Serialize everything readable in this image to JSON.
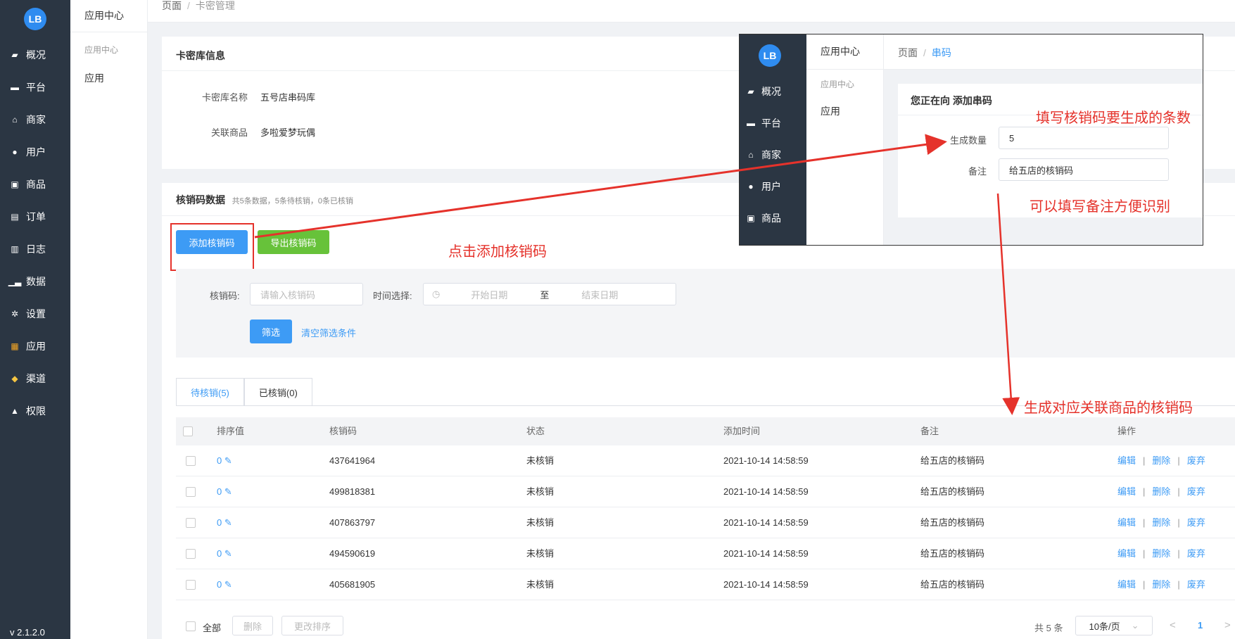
{
  "sidebar": {
    "logo": "LB",
    "items": [
      {
        "label": "概况",
        "icon": "dashboard-icon"
      },
      {
        "label": "平台",
        "icon": "monitor-icon"
      },
      {
        "label": "商家",
        "icon": "store-icon"
      },
      {
        "label": "用户",
        "icon": "user-icon"
      },
      {
        "label": "商品",
        "icon": "product-icon"
      },
      {
        "label": "订单",
        "icon": "order-icon"
      },
      {
        "label": "日志",
        "icon": "log-icon"
      },
      {
        "label": "数据",
        "icon": "chart-icon"
      },
      {
        "label": "设置",
        "icon": "gear-icon"
      },
      {
        "label": "应用",
        "icon": "apps-icon"
      },
      {
        "label": "渠道",
        "icon": "channel-icon"
      },
      {
        "label": "权限",
        "icon": "lock-icon"
      }
    ],
    "version": "v 2.1.2.0"
  },
  "sub_sidebar": {
    "title": "应用中心",
    "group": "应用中心",
    "item": "应用"
  },
  "breadcrumb": {
    "root": "页面",
    "current": "卡密管理"
  },
  "info_card": {
    "title": "卡密库信息",
    "name_label": "卡密库名称",
    "name_value": "五号店串码库",
    "product_label": "关联商品",
    "product_value": "多啦爱梦玩偶"
  },
  "data_card": {
    "title": "核销码数据",
    "summary": "共5条数据，5条待核销，0条已核销",
    "add_button": "添加核销码",
    "export_button": "导出核销码"
  },
  "filter": {
    "code_label": "核销码:",
    "code_placeholder": "请输入核销码",
    "time_label": "时间选择:",
    "start_placeholder": "开始日期",
    "to": "至",
    "end_placeholder": "结束日期",
    "filter_button": "筛选",
    "clear_link": "清空筛选条件"
  },
  "tabs": [
    {
      "label": "待核销(5)"
    },
    {
      "label": "已核销(0)"
    }
  ],
  "table": {
    "headers": [
      "排序值",
      "核销码",
      "状态",
      "添加时间",
      "备注",
      "操作"
    ],
    "rows": [
      {
        "sort": "0",
        "code": "437641964",
        "status": "未核销",
        "time": "2021-10-14 14:58:59",
        "note": "给五店的核销码"
      },
      {
        "sort": "0",
        "code": "499818381",
        "status": "未核销",
        "time": "2021-10-14 14:58:59",
        "note": "给五店的核销码"
      },
      {
        "sort": "0",
        "code": "407863797",
        "status": "未核销",
        "time": "2021-10-14 14:58:59",
        "note": "给五店的核销码"
      },
      {
        "sort": "0",
        "code": "494590619",
        "status": "未核销",
        "time": "2021-10-14 14:58:59",
        "note": "给五店的核销码"
      },
      {
        "sort": "0",
        "code": "405681905",
        "status": "未核销",
        "time": "2021-10-14 14:58:59",
        "note": "给五店的核销码"
      }
    ],
    "actions": [
      "编辑",
      "删除",
      "废弃"
    ]
  },
  "footer": {
    "select_all": "全部",
    "delete_button": "删除",
    "sort_button": "更改排序",
    "total": "共 5 条",
    "page_size": "10条/页",
    "prev": "<",
    "page": "1",
    "next": ">"
  },
  "overlay": {
    "logo": "LB",
    "nav": [
      "概况",
      "平台",
      "商家",
      "用户",
      "商品"
    ],
    "sub_title": "应用中心",
    "sub_group": "应用中心",
    "sub_item": "应用",
    "crumb_root": "页面",
    "crumb_current": "串码",
    "card_title": "您正在向 添加串码",
    "qty_label": "生成数量",
    "qty_value": "5",
    "note_label": "备注",
    "note_value": "给五店的核销码"
  },
  "annotations": {
    "click_add": "点击添加核销码",
    "fill_count": "填写核销码要生成的条数",
    "fill_note": "可以填写备注方便识别",
    "generate": "生成对应关联商品的核销码"
  },
  "colors": {
    "accent": "#3d9bf5",
    "annotation": "#e5322b",
    "sidebar": "#2b3643"
  }
}
